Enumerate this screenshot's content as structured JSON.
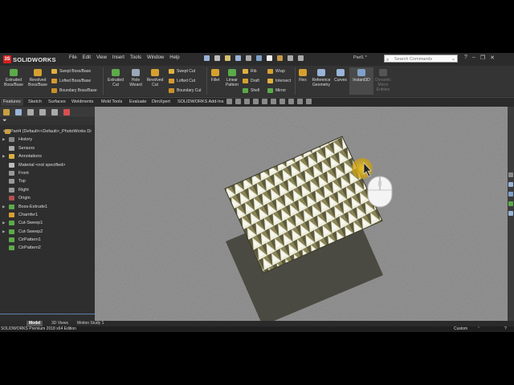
{
  "app": {
    "brand": "SOLIDWORKS",
    "menus": [
      "File",
      "Edit",
      "View",
      "Insert",
      "Tools",
      "Window",
      "Help"
    ],
    "document": "Part1 *",
    "search_placeholder": "Search Commands"
  },
  "ribbon": {
    "extruded_boss": "Extruded Boss/Base",
    "revolved_boss": "Revolved Boss/Base",
    "swept_boss": "Swept Boss/Base",
    "lofted_boss": "Lofted Boss/Base",
    "boundary_boss": "Boundary Boss/Base",
    "extruded_cut": "Extruded Cut",
    "hole_wizard": "Hole Wizard",
    "revolved_cut": "Revolved Cut",
    "swept_cut": "Swept Cut",
    "lofted_cut": "Lofted Cut",
    "boundary_cut": "Boundary Cut",
    "fillet": "Fillet",
    "linear_pattern": "Linear Pattern",
    "rib": "Rib",
    "draft": "Draft",
    "shell": "Shell",
    "wrap": "Wrap",
    "intersect": "Intersect",
    "mirror": "Mirror",
    "flex": "Flex",
    "reference_geometry": "Reference Geometry",
    "curves": "Curves",
    "instant3d": "Instant3D",
    "dynamic_mirror": "Dynamic Mirror Entities"
  },
  "tabs": [
    "Features",
    "Sketch",
    "Surfaces",
    "Weldments",
    "Mold Tools",
    "Evaluate",
    "DimXpert",
    "SOLIDWORKS Add-Ins"
  ],
  "tree": {
    "root": "Part4 (Default<<Default>_PhotoWorks Di",
    "items": [
      "History",
      "Sensors",
      "Annotations",
      "Material <not specified>",
      "Front",
      "Top",
      "Right",
      "Origin",
      "Boss-Extrude1",
      "Chamfer1",
      "Cut-Sweep1",
      "Cut-Sweep2",
      "CirPattern1",
      "CirPattern2"
    ]
  },
  "bottom_tabs": [
    "Model",
    "3D Views",
    "Motion Study 1"
  ],
  "status": {
    "edition": "SOLIDWORKS Premium 2018 x64 Edition",
    "units": "Custom",
    "help": "?"
  },
  "colors": {
    "logo_red": "#d62020",
    "viewport_grey": "#8f8f8f",
    "model_yellow": "#b8b07a",
    "cursor_highlight": "#d4b020",
    "selection_blue": "#5c7fb0"
  },
  "icons": [
    "solidworks-logo-icon",
    "search-icon",
    "mouse-icon",
    "cursor-highlight-icon",
    "filter-icon"
  ]
}
